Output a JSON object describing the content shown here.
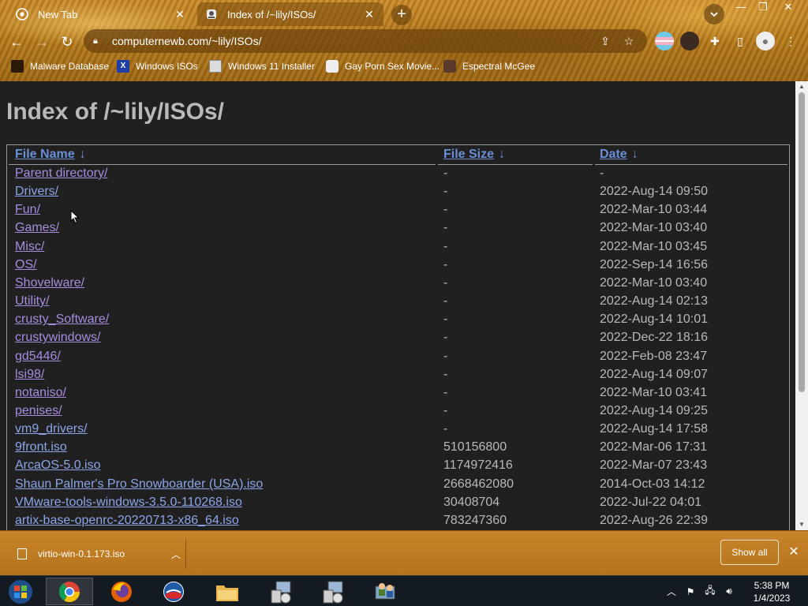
{
  "tabs": [
    {
      "title": "New Tab",
      "icon": "chrome-icon"
    },
    {
      "title": "Index of /~lily/ISOs/",
      "icon": "user-icon"
    }
  ],
  "address_bar": {
    "url": "computernewb.com/~lily/ISOs/"
  },
  "bookmarks": [
    {
      "label": "Malware Database"
    },
    {
      "label": "Windows ISOs"
    },
    {
      "label": "Windows 11 Installer"
    },
    {
      "label": "Gay Porn Sex Movie..."
    },
    {
      "label": "Espectral McGee"
    }
  ],
  "page": {
    "heading": "Index of /~lily/ISOs/",
    "columns": {
      "name": "File Name",
      "size": "File Size",
      "date": "Date",
      "sort_glyph": "↓"
    },
    "rows": [
      {
        "name": "Parent directory/",
        "size": "-",
        "date": "-"
      },
      {
        "name": "Drivers/",
        "size": "-",
        "date": "2022-Aug-14 09:50"
      },
      {
        "name": "Fun/",
        "size": "-",
        "date": "2022-Mar-10 03:44"
      },
      {
        "name": "Games/",
        "size": "-",
        "date": "2022-Mar-10 03:40"
      },
      {
        "name": "Misc/",
        "size": "-",
        "date": "2022-Mar-10 03:45"
      },
      {
        "name": "OS/",
        "size": "-",
        "date": "2022-Sep-14 16:56"
      },
      {
        "name": "Shovelware/",
        "size": "-",
        "date": "2022-Mar-10 03:40"
      },
      {
        "name": "Utility/",
        "size": "-",
        "date": "2022-Aug-14 02:13"
      },
      {
        "name": "crusty_Software/",
        "size": "-",
        "date": "2022-Aug-14 10:01"
      },
      {
        "name": "crustywindows/",
        "size": "-",
        "date": "2022-Dec-22 18:16"
      },
      {
        "name": "gd5446/",
        "size": "-",
        "date": "2022-Feb-08 23:47"
      },
      {
        "name": "lsi98/",
        "size": "-",
        "date": "2022-Aug-14 09:07"
      },
      {
        "name": "notaniso/",
        "size": "-",
        "date": "2022-Mar-10 03:41"
      },
      {
        "name": "penises/",
        "size": "-",
        "date": "2022-Aug-14 09:25"
      },
      {
        "name": "vm9_drivers/",
        "size": "-",
        "date": "2022-Aug-14 17:58"
      },
      {
        "name": "9front.iso",
        "size": "510156800",
        "date": "2022-Mar-06 17:31"
      },
      {
        "name": "ArcaOS-5.0.iso",
        "size": "1174972416",
        "date": "2022-Mar-07 23:43"
      },
      {
        "name": "Shaun Palmer's Pro Snowboarder (USA).iso",
        "size": "2668462080",
        "date": "2014-Oct-03 14:12"
      },
      {
        "name": "VMware-tools-windows-3.5.0-110268.iso",
        "size": "30408704",
        "date": "2022-Jul-22 04:01"
      },
      {
        "name": "artix-base-openrc-20220713-x86_64.iso",
        "size": "783247360",
        "date": "2022-Aug-26 22:39"
      }
    ]
  },
  "downloads": {
    "file": "virtio-win-0.1.173.iso",
    "show_all": "Show all"
  },
  "taskbar": {
    "time": "5:38 PM",
    "date": "1/4/2023"
  },
  "colors": {
    "link": "#8ba5e8",
    "visited_link": "#a98be0",
    "page_bg": "#202020",
    "chrome": "#c98a2a"
  }
}
